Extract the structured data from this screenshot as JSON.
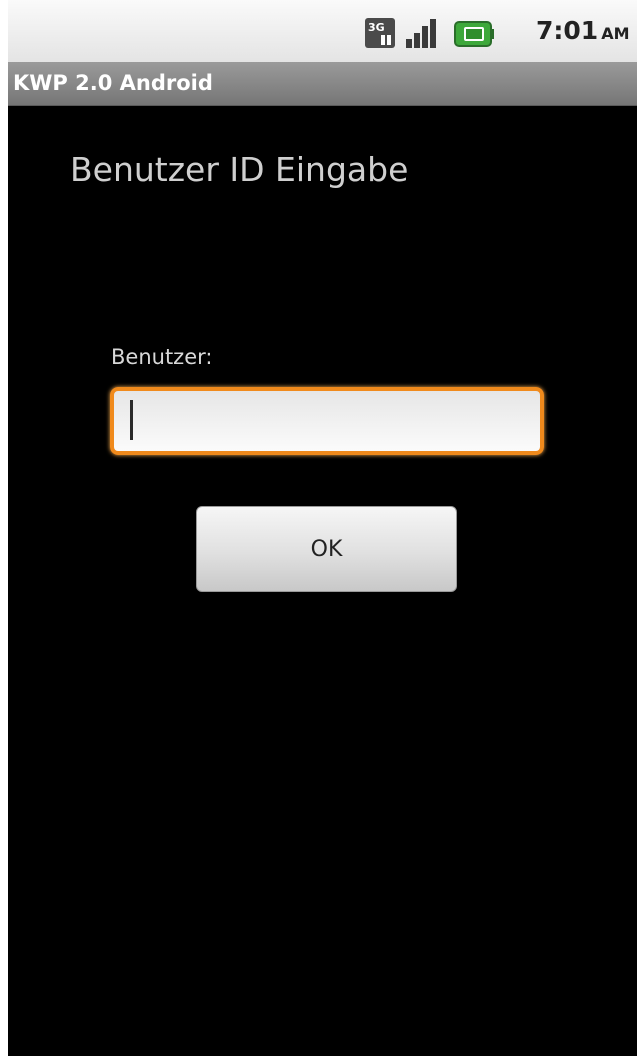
{
  "status_bar": {
    "network_icon": "3g-network-icon",
    "signal_icon": "signal-strength-icon",
    "battery_icon": "battery-charging-icon",
    "time": "7:01",
    "ampm": "AM",
    "network_label": "3G"
  },
  "title_bar": {
    "title": "KWP 2.0 Android"
  },
  "form": {
    "heading": "Benutzer ID Eingabe",
    "user_label": "Benutzer:",
    "user_value": "",
    "ok_label": "OK"
  },
  "colors": {
    "focus_accent": "#f08a1c",
    "background": "#000000",
    "battery_accent": "#3da83a"
  }
}
